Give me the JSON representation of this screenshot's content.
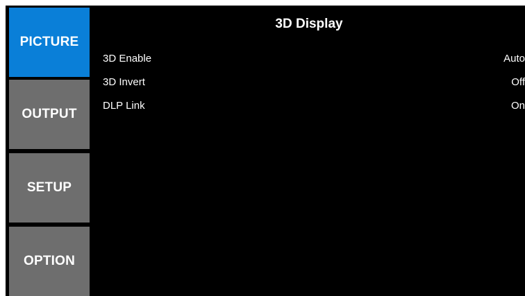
{
  "sidebar": {
    "tabs": [
      {
        "label": "PICTURE",
        "active": true
      },
      {
        "label": "OUTPUT",
        "active": false
      },
      {
        "label": "SETUP",
        "active": false
      },
      {
        "label": "OPTION",
        "active": false
      }
    ]
  },
  "panel": {
    "title": "3D Display",
    "settings": [
      {
        "label": "3D Enable",
        "value": "Auto"
      },
      {
        "label": "3D Invert",
        "value": "Off"
      },
      {
        "label": "DLP Link",
        "value": "On"
      }
    ]
  },
  "colors": {
    "background": "#000000",
    "active_tab": "#0a7fd8",
    "inactive_tab": "#6e6e6e",
    "text": "#ffffff"
  }
}
